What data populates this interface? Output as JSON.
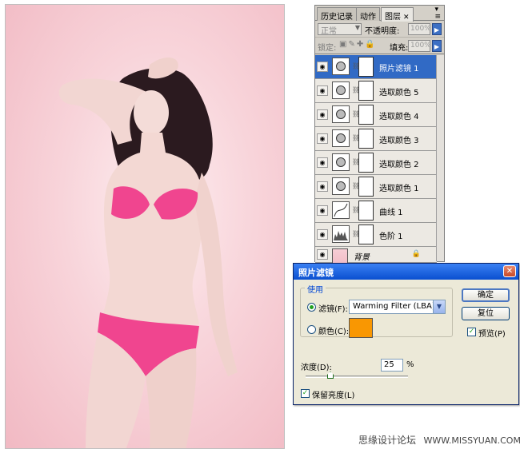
{
  "layers_panel": {
    "tabs": [
      {
        "label": "历史记录"
      },
      {
        "label": "动作"
      },
      {
        "label": "图层",
        "active": true
      }
    ],
    "blend_mode": "正常",
    "opacity_label": "不透明度:",
    "opacity_value": "100%",
    "lock_label": "锁定:",
    "fill_label": "填充:",
    "fill_value": "100%",
    "layers": [
      {
        "name": "照片滤镜 1",
        "selected": true
      },
      {
        "name": "选取颜色 5"
      },
      {
        "name": "选取颜色 4"
      },
      {
        "name": "选取颜色 3"
      },
      {
        "name": "选取颜色 2"
      },
      {
        "name": "选取颜色 1"
      },
      {
        "name": "曲线 1"
      },
      {
        "name": "色阶 1"
      }
    ],
    "background_layer": {
      "name": "背景"
    }
  },
  "dialog": {
    "title": "照片滤镜",
    "group_label": "使用",
    "filter_label": "滤镜(F):",
    "filter_value": "Warming Filter (LBA)",
    "color_label": "颜色(C):",
    "color_swatch": "#f99702",
    "ok_label": "确定",
    "reset_label": "复位",
    "preview_label": "预览(P)",
    "preview_checked": true,
    "density_label": "浓度(D):",
    "density_value": "25",
    "density_unit": "%",
    "preserve_luminosity_label": "保留亮度(L)",
    "preserve_luminosity_checked": true
  },
  "watermark": {
    "site_cn": "思缘设计论坛",
    "site_url": "WWW.MISSYUAN.COM"
  },
  "colors": {
    "selection_blue": "#316ac5",
    "xp_title_blue": "#0a4fd0",
    "swimsuit_pink": "#f0458f"
  }
}
